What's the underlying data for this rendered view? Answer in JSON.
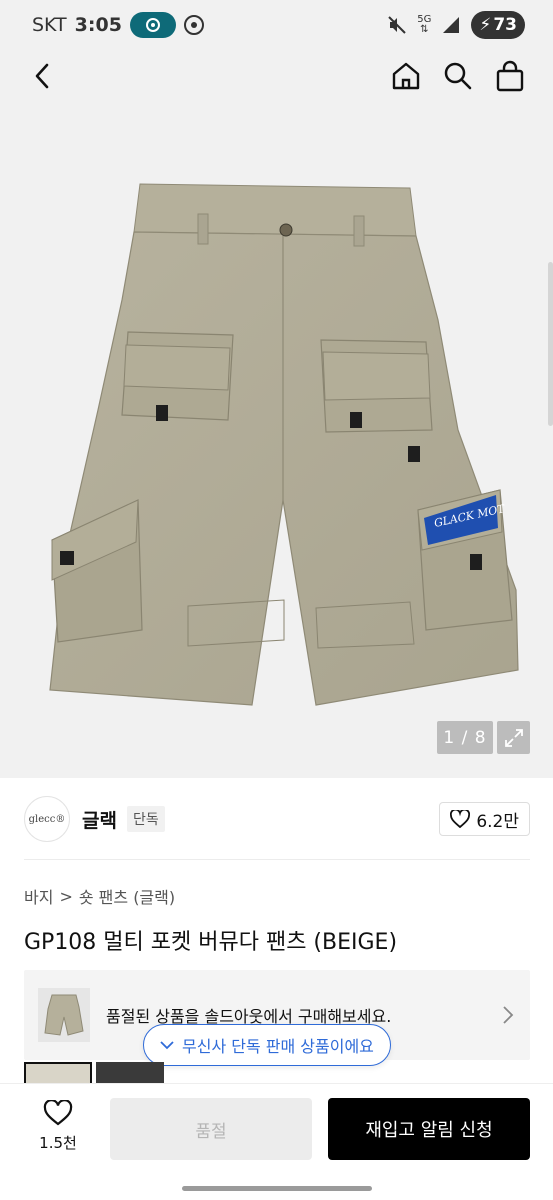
{
  "status_bar": {
    "carrier": "SKT",
    "time": "3:05",
    "network": "5G",
    "battery": "73"
  },
  "app_bar": {
    "icons": [
      "back-icon",
      "home-icon",
      "search-icon",
      "bag-icon"
    ]
  },
  "gallery": {
    "counter": "1 / 8",
    "print_text": "GLACK MOT"
  },
  "brand": {
    "logo_text": "glecc®",
    "name": "글랙",
    "tag": "단독",
    "likes": "6.2만"
  },
  "breadcrumb": {
    "category": "바지",
    "separator": ">",
    "subcategory": "숏 팬츠 (글랙)"
  },
  "product": {
    "title": "GP108 멀티 포켓 버뮤다 팬츠 (BEIGE)"
  },
  "promo": {
    "text": "품절된 상품을 솔드아웃에서 구매해보세요."
  },
  "exclusive_notice": {
    "text": "무신사 단독 판매 상품이에요"
  },
  "bottom_bar": {
    "wish_count": "1.5천",
    "soldout_label": "품절",
    "restock_label": "재입고 알림 신청"
  },
  "colors": {
    "accent_blue": "#2f6bd8",
    "primary_black": "#000000",
    "disabled_grey": "#ececec"
  }
}
